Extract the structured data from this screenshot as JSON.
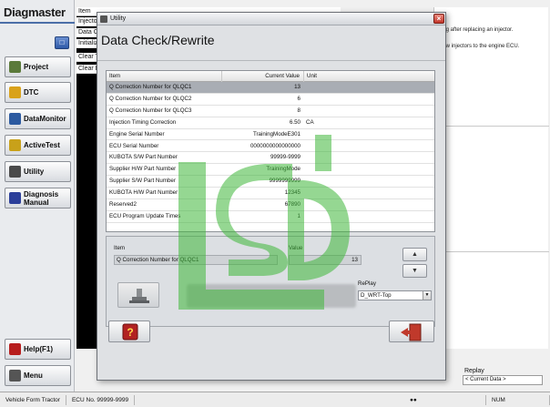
{
  "app": {
    "brand": "Diagmaster",
    "nav": [
      {
        "label": "Project",
        "icon": "project-icon",
        "color": "#5a7a3a"
      },
      {
        "label": "DTC",
        "icon": "dtc-icon",
        "color": "#d9a21b"
      },
      {
        "label": "DataMonitor",
        "icon": "data-monitor-icon",
        "color": "#2c5aa0"
      },
      {
        "label": "ActiveTest",
        "icon": "active-test-icon",
        "color": "#c8a11a"
      },
      {
        "label": "Utility",
        "icon": "utility-icon",
        "color": "#4a4a4a"
      },
      {
        "label": "Diagnosis Manual",
        "icon": "diagnosis-manual-icon",
        "color": "#2b3e9a"
      }
    ],
    "help_label": "Help(F1)",
    "menu_label": "Menu"
  },
  "background": {
    "list_header": "Item",
    "rows": [
      "Injector C",
      "Data Chec",
      "Initializati",
      "Clear Trip",
      "Clear EGR"
    ],
    "notes": [
      "ring after replacing an injector.",
      "new injectors to the engine ECU."
    ],
    "replay_label": "Replay",
    "replay_value": "< Current Data >"
  },
  "status": {
    "model": "Vehicle Form Tractor",
    "ecu": "ECU No. 99999-9999",
    "mode": "NUM"
  },
  "dialog": {
    "window_title": "Utility",
    "heading": "Data Check/Rewrite",
    "columns": {
      "item": "Item",
      "value": "Current Value",
      "unit": "Unit"
    },
    "rows": [
      {
        "item": "Q Correction Number for QLQC1",
        "value": "13",
        "unit": ""
      },
      {
        "item": "Q Correction Number for QLQC2",
        "value": "6",
        "unit": ""
      },
      {
        "item": "Q Correction Number for QLQC3",
        "value": "8",
        "unit": ""
      },
      {
        "item": "Injection Timing Correction",
        "value": "6.50",
        "unit": "CA"
      },
      {
        "item": "Engine Serial Number",
        "value": "TrainingModeE301",
        "unit": ""
      },
      {
        "item": "ECU Serial Number",
        "value": "0000000000000000",
        "unit": ""
      },
      {
        "item": "KUBOTA S/W Part Number",
        "value": "99999-9999",
        "unit": ""
      },
      {
        "item": "Supplier H/W Part Number",
        "value": "TrainingMode",
        "unit": ""
      },
      {
        "item": "Supplier S/W Part Number",
        "value": "9999999999",
        "unit": ""
      },
      {
        "item": "KUBOTA H/W Part Number",
        "value": "12345",
        "unit": ""
      },
      {
        "item": "Reserved2",
        "value": "67890",
        "unit": ""
      },
      {
        "item": "ECU Program Update Times",
        "value": "1",
        "unit": ""
      }
    ],
    "detail": {
      "item_label": "Item",
      "item_value": "Q Correction Number for QLQC1",
      "value_label": "Value",
      "value_value": "13",
      "replay_label": "RePlay",
      "replay_value": "D_WRT-Top"
    }
  }
}
